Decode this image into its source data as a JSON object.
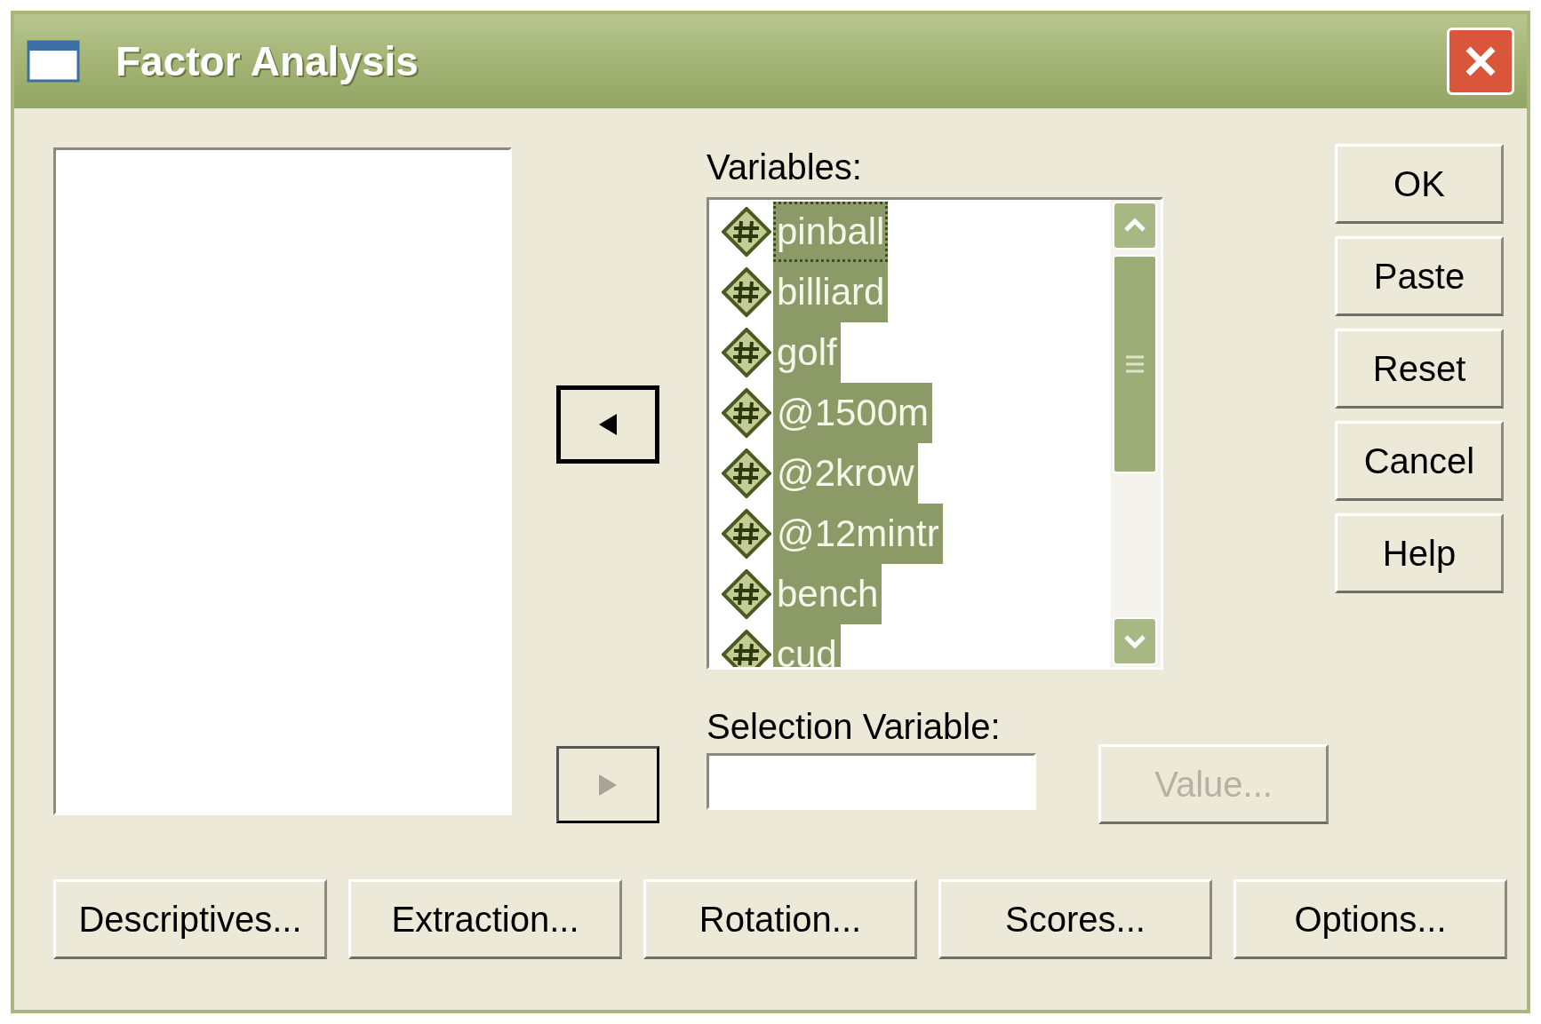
{
  "window": {
    "title": "Factor Analysis"
  },
  "variables": {
    "label": "Variables:",
    "items": [
      {
        "name": "pinball",
        "selected": true,
        "focused": true
      },
      {
        "name": "billiard",
        "selected": true,
        "focused": false
      },
      {
        "name": "golf",
        "selected": true,
        "focused": false
      },
      {
        "name": "@1500m",
        "selected": true,
        "focused": false
      },
      {
        "name": "@2krow",
        "selected": true,
        "focused": false
      },
      {
        "name": "@12mintr",
        "selected": true,
        "focused": false
      },
      {
        "name": "bench",
        "selected": true,
        "focused": false
      },
      {
        "name": "cud",
        "selected": true,
        "focused": false
      }
    ]
  },
  "move_buttons": [
    {
      "kind": "left",
      "default": true
    },
    {
      "kind": "right",
      "default": false
    }
  ],
  "selection_variable": {
    "label": "Selection Variable:",
    "value_button": {
      "label": "Value...",
      "disabled": true
    }
  },
  "side_buttons": [
    {
      "label": "OK",
      "disabled": false
    },
    {
      "label": "Paste",
      "disabled": false
    },
    {
      "label": "Reset",
      "disabled": false
    },
    {
      "label": "Cancel",
      "disabled": false
    },
    {
      "label": "Help",
      "disabled": false
    }
  ],
  "bottom_buttons": [
    {
      "label": "Descriptives...",
      "disabled": false
    },
    {
      "label": "Extraction...",
      "disabled": false
    },
    {
      "label": "Rotation...",
      "disabled": false
    },
    {
      "label": "Scores...",
      "disabled": false
    },
    {
      "label": "Options...",
      "disabled": false
    }
  ]
}
